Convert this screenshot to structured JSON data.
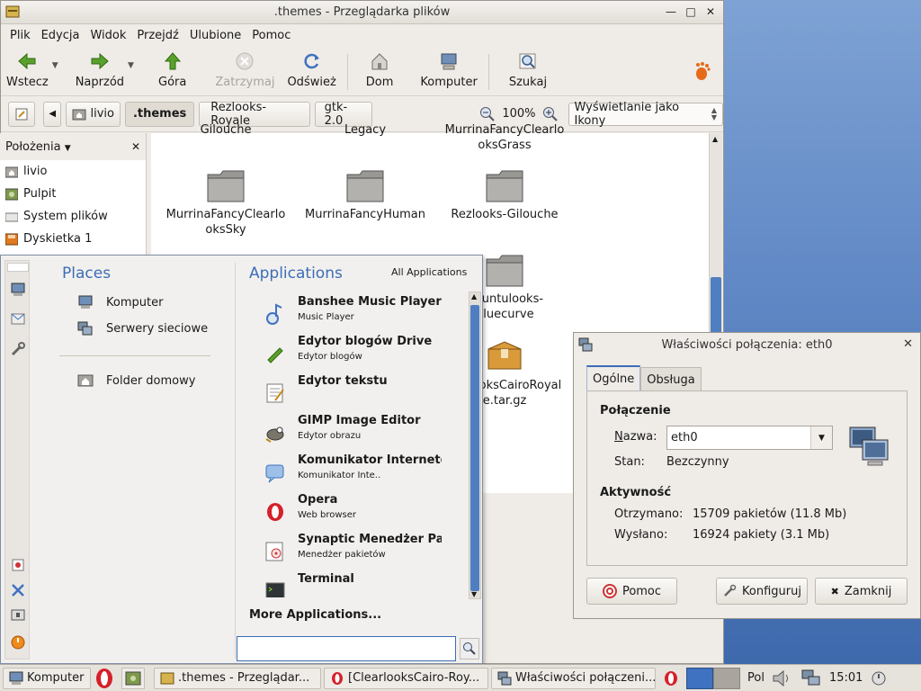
{
  "file_manager": {
    "title": ".themes - Przeglądarka plików",
    "menu": [
      "Plik",
      "Edycja",
      "Widok",
      "Przejdź",
      "Ulubione",
      "Pomoc"
    ],
    "toolbar": {
      "back": "Wstecz",
      "forward": "Naprzód",
      "up": "Góra",
      "stop": "Zatrzymaj",
      "reload": "Odśwież",
      "home": "Dom",
      "computer": "Komputer",
      "search": "Szukaj"
    },
    "path": [
      "livio",
      ".themes",
      "Rezlooks-Royale",
      "gtk-2.0"
    ],
    "zoom": "100%",
    "view_mode": "Wyświetlanie jako Ikony",
    "sidebar": {
      "header": "Położenia",
      "items": [
        "livio",
        "Pulpit",
        "System plików",
        "Dyskietka 1"
      ]
    },
    "top_partial": [
      "Gilouche",
      "Legacy",
      "MurrinaFancyClearlo oksGrass"
    ],
    "files": [
      "MurrinaFancyClearlo oksSky",
      "MurrinaFancyHuman",
      "Rezlooks-Gilouche",
      "Ubuntulooks- Bluecurve",
      "RezlooksCairoRoyal e.tar.gz"
    ]
  },
  "menu": {
    "places_title": "Places",
    "places": [
      "Komputer",
      "Serwery sieciowe"
    ],
    "home_folder": "Folder domowy",
    "apps_title": "Applications",
    "all_apps": "All Applications",
    "apps": [
      {
        "name": "Banshee Music Player",
        "desc": "Music Player"
      },
      {
        "name": "Edytor blogów Drive",
        "desc": "Edytor blogów"
      },
      {
        "name": "Edytor tekstu",
        "desc": ""
      },
      {
        "name": "GIMP Image Editor",
        "desc": "Edytor obrazu"
      },
      {
        "name": "Komunikator Internetowy",
        "desc": "Komunikator Inte.."
      },
      {
        "name": "Opera",
        "desc": "Web browser"
      },
      {
        "name": "Synaptic Menedżer Pakietów",
        "desc": "Menedżer pakietów"
      },
      {
        "name": "Terminal",
        "desc": ""
      }
    ],
    "more_apps": "More Applications..."
  },
  "dialog": {
    "title": "Właściwości połączenia: eth0",
    "tabs": [
      "Ogólne",
      "Obsługa"
    ],
    "connection_header": "Połączenie",
    "name_label": "Nazwa:",
    "name_value": "eth0",
    "state_label": "Stan:",
    "state_value": "Bezczynny",
    "activity_header": "Aktywność",
    "received_label": "Otrzymano:",
    "received_value": "15709 pakietów (11.8 Mb)",
    "sent_label": "Wysłano:",
    "sent_value": "16924 pakiety (3.1 Mb)",
    "help": "Pomoc",
    "configure": "Konfiguruj",
    "close": "Zamknij"
  },
  "taskbar": {
    "start": "Komputer",
    "windows": [
      ".themes - Przeglądar...",
      "[ClearlooksCairo-Roy...",
      "Właściwości połączeni..."
    ],
    "keyboard": "Pol",
    "clock": "15:01"
  }
}
